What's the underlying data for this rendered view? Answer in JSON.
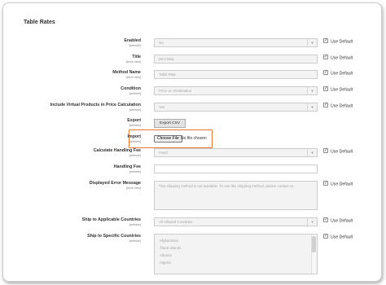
{
  "section": {
    "title": "Table Rates"
  },
  "use_default_label": "Use Default",
  "fields": {
    "enabled": {
      "label": "Enabled",
      "scope": "[website]",
      "value": "No"
    },
    "title": {
      "label": "Title",
      "scope": "[store view]",
      "placeholder": "Best Way"
    },
    "method_name": {
      "label": "Method Name",
      "scope": "[store view]",
      "placeholder": "Table Rate"
    },
    "condition": {
      "label": "Condition",
      "scope": "[website]",
      "value": "Price vs. Destination"
    },
    "include_virtual": {
      "label": "Include Virtual Products in Price Calculation",
      "scope": "[website]",
      "value": "Yes"
    },
    "export": {
      "label": "Export",
      "scope": "[website]",
      "button": "Export CSV"
    },
    "import": {
      "label": "Import",
      "scope": "[website]",
      "button": "Choose File",
      "status": "No file chosen"
    },
    "calc_handling_fee": {
      "label": "Calculate Handling Fee",
      "scope": "[website]",
      "value": "Fixed"
    },
    "handling_fee": {
      "label": "Handling Fee",
      "scope": "[website]"
    },
    "error_message": {
      "label": "Displayed Error Message",
      "scope": "[store view]",
      "value": "This shipping method is not available. To use this shipping method, please contact us."
    },
    "ship_applicable": {
      "label": "Ship to Applicable Countries",
      "scope": "[website]",
      "value": "All Allowed Countries"
    },
    "ship_specific": {
      "label": "Ship to Specific Countries",
      "scope": "[website]",
      "options": [
        "Afghanistan",
        "Åland Islands",
        "Albania",
        "Algeria"
      ]
    }
  }
}
